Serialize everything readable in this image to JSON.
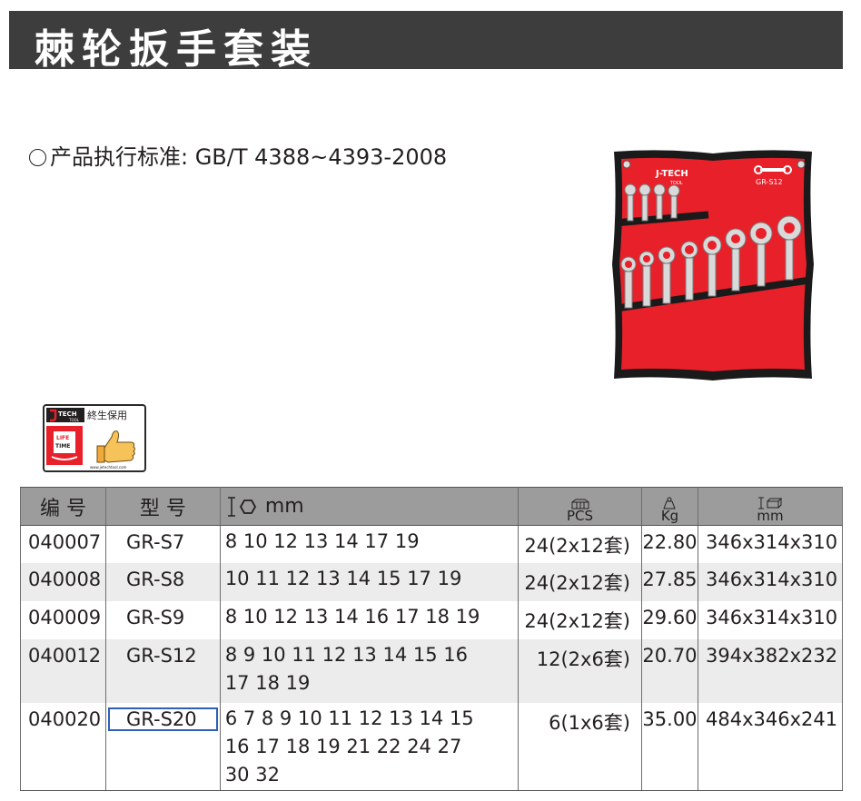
{
  "title": "棘轮扳手套装",
  "standard": "产品执行标准: GB/T 4388~4393-2008",
  "product_photo": {
    "brand": "J-TECH",
    "brand_sub": "TOOL",
    "model": "GR-S12"
  },
  "badge": {
    "brand": "TECH",
    "brand_sub": "TOOL",
    "slogan": "終生保用",
    "life": "LIFE",
    "time": "TIME",
    "url": "www.jetechtool.com"
  },
  "table": {
    "headers": {
      "num": "编 号",
      "model": "型 号",
      "sizes_unit": "mm",
      "pcs": "PCS",
      "kg": "Kg",
      "dim_unit": "mm"
    },
    "rows": [
      {
        "num": "040007",
        "model": "GR-S7",
        "sizes": [
          "8 10 12 13 14 17 19"
        ],
        "pcs": "24(2x12套)",
        "kg": "22.80",
        "dim": "346x314x310"
      },
      {
        "num": "040008",
        "model": "GR-S8",
        "sizes": [
          "10 11 12 13 14 15 17 19"
        ],
        "pcs": "24(2x12套)",
        "kg": "27.85",
        "dim": "346x314x310"
      },
      {
        "num": "040009",
        "model": "GR-S9",
        "sizes": [
          "8 10 12 13 14 16 17 18 19"
        ],
        "pcs": "24(2x12套)",
        "kg": "29.60",
        "dim": "346x314x310"
      },
      {
        "num": "040012",
        "model": "GR-S12",
        "sizes": [
          "8 9 10 11 12 13 14 15 16",
          "17 18 19"
        ],
        "pcs": "12(2x6套)",
        "kg": "20.70",
        "dim": "394x382x232"
      },
      {
        "num": "040020",
        "model": "GR-S20",
        "sizes": [
          "6 7 8 9 10 11 12 13 14 15",
          "16 17 18 19 21 22 24 27",
          "30 32"
        ],
        "pcs": "6(1x6套)",
        "kg": "35.00",
        "dim": "484x346x241"
      }
    ]
  },
  "colors": {
    "title_bar": "#3d3d3d",
    "header_bg": "#9c9c9c",
    "stripe": "#ececec",
    "pouch_red": "#e8202a",
    "highlight": "#2f5fb7"
  }
}
